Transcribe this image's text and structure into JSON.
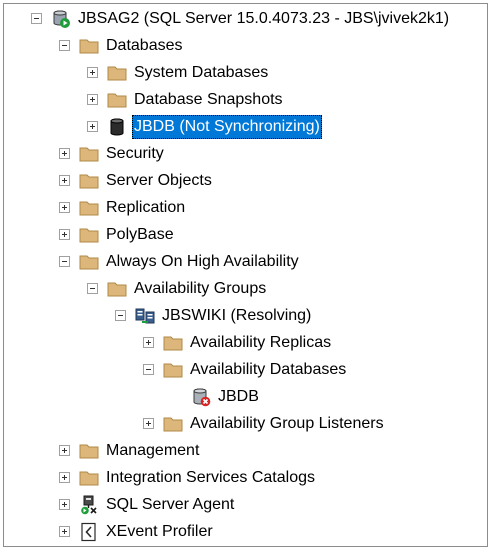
{
  "tree": {
    "server": {
      "label": "JBSAG2 (SQL Server 15.0.4073.23 - JBS\\jvivek2k1)",
      "icon": "server-connected-icon",
      "expanded": true
    },
    "databases": {
      "label": "Databases",
      "icon": "folder-icon",
      "expanded": true
    },
    "system_databases": {
      "label": "System Databases",
      "icon": "folder-icon",
      "expanded": false
    },
    "database_snapshots": {
      "label": "Database Snapshots",
      "icon": "folder-icon",
      "expanded": false
    },
    "jbdb_db": {
      "label": "JBDB (Not Synchronizing)",
      "icon": "database-icon",
      "expanded": false,
      "selected": true
    },
    "security": {
      "label": "Security",
      "icon": "folder-icon",
      "expanded": false
    },
    "server_objects": {
      "label": "Server Objects",
      "icon": "folder-icon",
      "expanded": false
    },
    "replication": {
      "label": "Replication",
      "icon": "folder-icon",
      "expanded": false
    },
    "polybase": {
      "label": "PolyBase",
      "icon": "folder-icon",
      "expanded": false
    },
    "always_on": {
      "label": "Always On High Availability",
      "icon": "folder-icon",
      "expanded": true
    },
    "availability_groups": {
      "label": "Availability Groups",
      "icon": "folder-icon",
      "expanded": true
    },
    "jbswiki": {
      "label": "JBSWIKI (Resolving)",
      "icon": "availability-group-icon",
      "expanded": true
    },
    "availability_replicas": {
      "label": "Availability Replicas",
      "icon": "folder-icon",
      "expanded": false
    },
    "availability_databases": {
      "label": "Availability Databases",
      "icon": "folder-icon",
      "expanded": true
    },
    "jbdb_ag": {
      "label": "JBDB",
      "icon": "database-error-icon"
    },
    "ag_listeners": {
      "label": "Availability Group Listeners",
      "icon": "folder-icon",
      "expanded": false
    },
    "management": {
      "label": "Management",
      "icon": "folder-icon",
      "expanded": false
    },
    "integration_services": {
      "label": "Integration Services Catalogs",
      "icon": "folder-icon",
      "expanded": false
    },
    "sql_agent": {
      "label": "SQL Server Agent",
      "icon": "sql-agent-icon",
      "expanded": false
    },
    "xevent_profiler": {
      "label": "XEvent Profiler",
      "icon": "xevent-profiler-icon",
      "expanded": false
    }
  },
  "colors": {
    "selection": "#0078d7",
    "folder": "#dcb67a",
    "status_green": "#1e9e3a",
    "status_red": "#d92525"
  }
}
